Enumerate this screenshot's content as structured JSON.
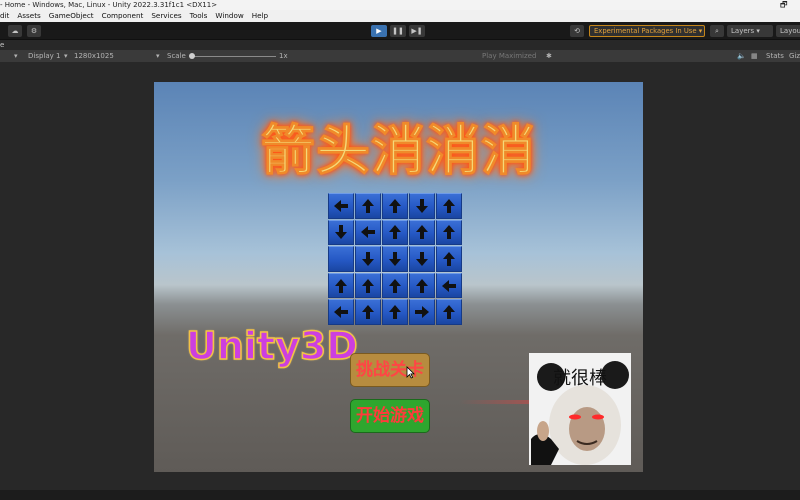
{
  "window": {
    "title": "- Home - Windows, Mac, Linux - Unity 2022.3.31f1c1 <DX11>",
    "restore_glyph": "🗗"
  },
  "menu": [
    "dit",
    "Assets",
    "GameObject",
    "Component",
    "Services",
    "Tools",
    "Window",
    "Help"
  ],
  "toolbar": {
    "play": "▶",
    "pause": "❚❚",
    "step": "▶❚",
    "experimental": "Experimental Packages In Use ▾",
    "layers": "Layers ▾",
    "layout": "Layout"
  },
  "game_view": {
    "tab_label": "e",
    "display": "Display 1",
    "resolution": "1280x1025",
    "scale_label": "Scale",
    "scale_value": "1x",
    "play_mode": "Play Maximized",
    "stats": "Stats",
    "gizmos": "Giz"
  },
  "game": {
    "title": "箭头消消消",
    "grid": [
      [
        "left",
        "up",
        "up",
        "down",
        "up"
      ],
      [
        "down",
        "left",
        "up",
        "up",
        "up"
      ],
      [
        "none",
        "down",
        "down",
        "down",
        "up"
      ],
      [
        "up",
        "up",
        "up",
        "up",
        "left"
      ],
      [
        "left",
        "up",
        "up",
        "right",
        "up"
      ]
    ],
    "unity_logo": "Unity3D",
    "challenge_button": "挑战关卡",
    "start_button": "开始游戏",
    "meme_caption": "就很棒"
  },
  "colors": {
    "play_active": "#3a72b0",
    "tile_blue": "#2558c4",
    "title_glow": "#ff5a1a",
    "challenge_bg": "#b78c3f",
    "start_bg": "#2ea62e",
    "button_text": "#ff3b3b"
  }
}
